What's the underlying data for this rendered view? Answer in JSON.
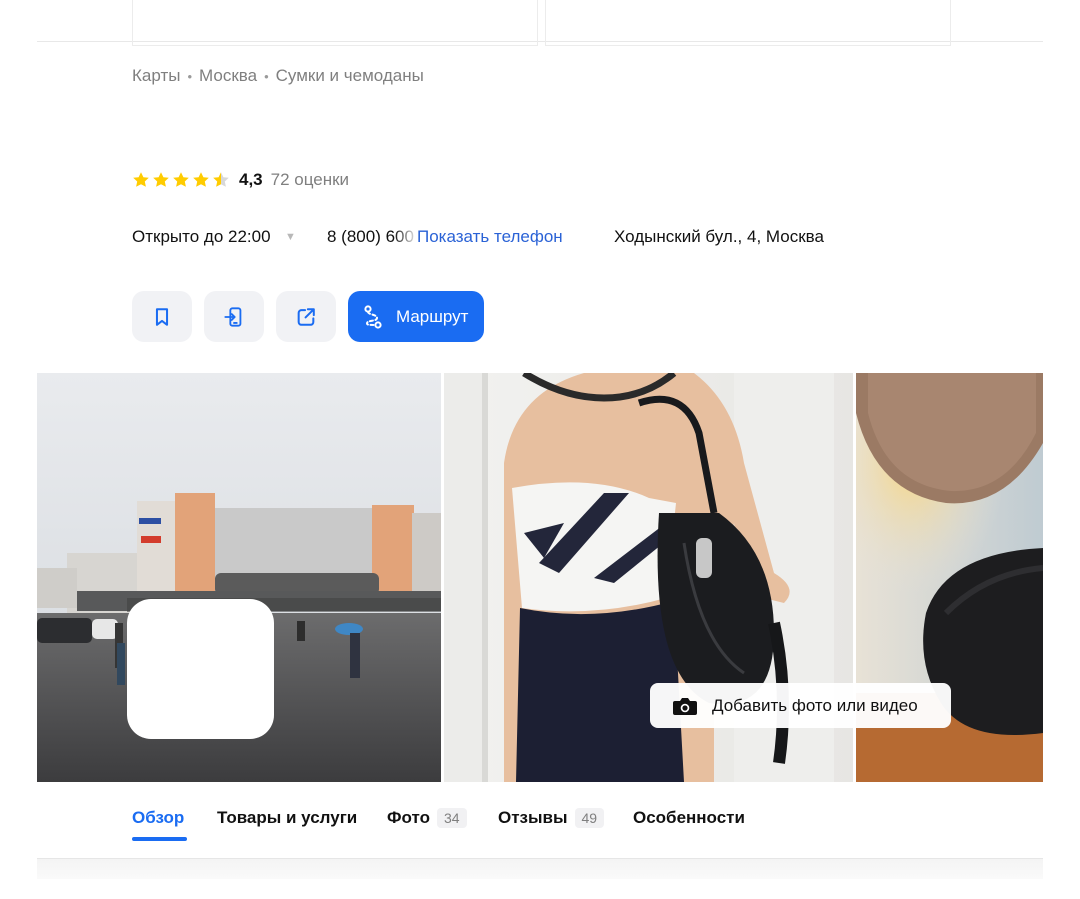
{
  "breadcrumbs": [
    "Карты",
    "Москва",
    "Сумки и чемоданы"
  ],
  "breadcrumb_separator": "•",
  "rating": {
    "value": "4,3",
    "stars": 4.5,
    "count_label": "72 оценки",
    "star_color": "#ffcc00"
  },
  "hours": {
    "label": "Открыто до 22:00"
  },
  "phone": {
    "partial": "8 (800) 600",
    "show_label": "Показать телефон"
  },
  "address": "Ходынский бул., 4, Москва",
  "actions": {
    "bookmark_icon": "bookmark-icon",
    "send_to_phone_icon": "send-to-phone-icon",
    "share_icon": "share-icon",
    "route_label": "Маршрут",
    "route_icon": "route-icon"
  },
  "gallery": {
    "add_photo_label": "Добавить фото или видео",
    "add_photo_icon": "camera-icon"
  },
  "tabs": [
    {
      "label": "Обзор",
      "count": ""
    },
    {
      "label": "Товары и услуги",
      "count": ""
    },
    {
      "label": "Фото",
      "count": "34"
    },
    {
      "label": "Отзывы",
      "count": "49"
    },
    {
      "label": "Особенности",
      "count": ""
    }
  ],
  "colors": {
    "accent": "#1a6cf2",
    "link": "#2a62d6",
    "muted": "#7f7f7f",
    "button_bg": "#f1f2f5"
  }
}
